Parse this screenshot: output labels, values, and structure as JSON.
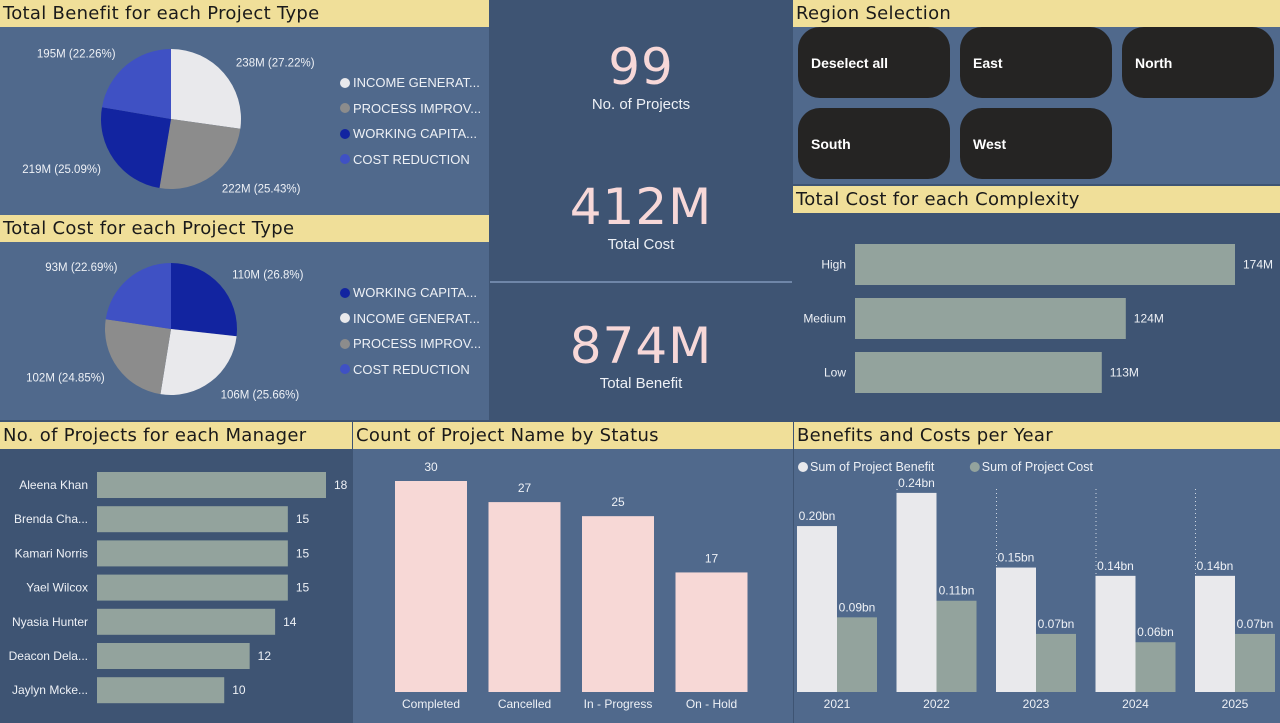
{
  "benefit_type": {
    "title": "Total Benefit for each Project Type",
    "legend": [
      {
        "label": "INCOME GENERAT...",
        "color": "#e9e9ec"
      },
      {
        "label": "PROCESS IMPROV...",
        "color": "#8c8c8c"
      },
      {
        "label": "WORKING CAPITA...",
        "color": "#1224a0"
      },
      {
        "label": "COST REDUCTION",
        "color": "#3f51c4"
      }
    ],
    "chart_data": {
      "type": "pie",
      "labels": [
        "INCOME GENERATION",
        "PROCESS IMPROVEMENT",
        "WORKING CAPITAL",
        "COST REDUCTION"
      ],
      "values": [
        238,
        222,
        219,
        195
      ],
      "data_labels": [
        "238M (27.22%)",
        "222M (25.43%)",
        "219M (25.09%)",
        "195M (22.26%)"
      ],
      "colors": [
        "#e9e9ec",
        "#8c8c8c",
        "#1224a0",
        "#3f51c4"
      ]
    }
  },
  "cost_type": {
    "title": "Total Cost for each Project Type",
    "legend": [
      {
        "label": "WORKING CAPITA...",
        "color": "#1224a0"
      },
      {
        "label": "INCOME GENERAT...",
        "color": "#e9e9ec"
      },
      {
        "label": "PROCESS IMPROV...",
        "color": "#8c8c8c"
      },
      {
        "label": "COST REDUCTION",
        "color": "#3f51c4"
      }
    ],
    "chart_data": {
      "type": "pie",
      "labels": [
        "WORKING CAPITAL",
        "INCOME GENERATION",
        "PROCESS IMPROVEMENT",
        "COST REDUCTION"
      ],
      "values": [
        110,
        106,
        102,
        93
      ],
      "data_labels": [
        "110M (26.8%)",
        "106M (25.66%)",
        "102M (24.85%)",
        "93M (22.69%)"
      ],
      "colors": [
        "#1224a0",
        "#e9e9ec",
        "#8c8c8c",
        "#3f51c4"
      ]
    }
  },
  "kpis": {
    "projects": {
      "value": "99",
      "label": "No. of Projects"
    },
    "cost": {
      "value": "412M",
      "label": "Total Cost"
    },
    "benefit": {
      "value": "874M",
      "label": "Total Benefit"
    }
  },
  "region": {
    "title": "Region Selection",
    "buttons": [
      "Deselect all",
      "East",
      "North",
      "South",
      "West"
    ]
  },
  "complexity": {
    "title": "Total Cost for each Complexity",
    "chart_data": {
      "type": "bar",
      "orientation": "horizontal",
      "categories": [
        "High",
        "Medium",
        "Low"
      ],
      "values": [
        174,
        124,
        113
      ],
      "data_labels": [
        "174M",
        "124M",
        "113M"
      ],
      "color": "#93a39d"
    }
  },
  "managers": {
    "title": "No. of Projects for each Manager",
    "chart_data": {
      "type": "bar",
      "orientation": "horizontal",
      "categories": [
        "Aleena Khan",
        "Brenda Cha...",
        "Kamari Norris",
        "Yael Wilcox",
        "Nyasia Hunter",
        "Deacon Dela...",
        "Jaylyn Mcke..."
      ],
      "values": [
        18,
        15,
        15,
        15,
        14,
        12,
        10
      ],
      "color": "#93a39d"
    }
  },
  "status": {
    "title": "Count of Project Name by Status",
    "chart_data": {
      "type": "bar",
      "categories": [
        "Completed",
        "Cancelled",
        "In - Progress",
        "On - Hold"
      ],
      "values": [
        30,
        27,
        25,
        17
      ],
      "color": "#f7d8d6"
    }
  },
  "yearly": {
    "title": "Benefits and Costs per Year",
    "chart_data": {
      "type": "bar",
      "categories": [
        "2021",
        "2022",
        "2023",
        "2024",
        "2025"
      ],
      "series": [
        {
          "name": "Sum of Project Benefit",
          "values": [
            0.2,
            0.24,
            0.15,
            0.14,
            0.14
          ],
          "labels": [
            "0.20bn",
            "0.24bn",
            "0.15bn",
            "0.14bn",
            "0.14bn"
          ],
          "color": "#e9e9ec"
        },
        {
          "name": "Sum of Project Cost",
          "values": [
            0.09,
            0.11,
            0.07,
            0.06,
            0.07
          ],
          "labels": [
            "0.09bn",
            "0.11bn",
            "0.07bn",
            "0.06bn",
            "0.07bn"
          ],
          "color": "#93a39d"
        }
      ]
    }
  }
}
